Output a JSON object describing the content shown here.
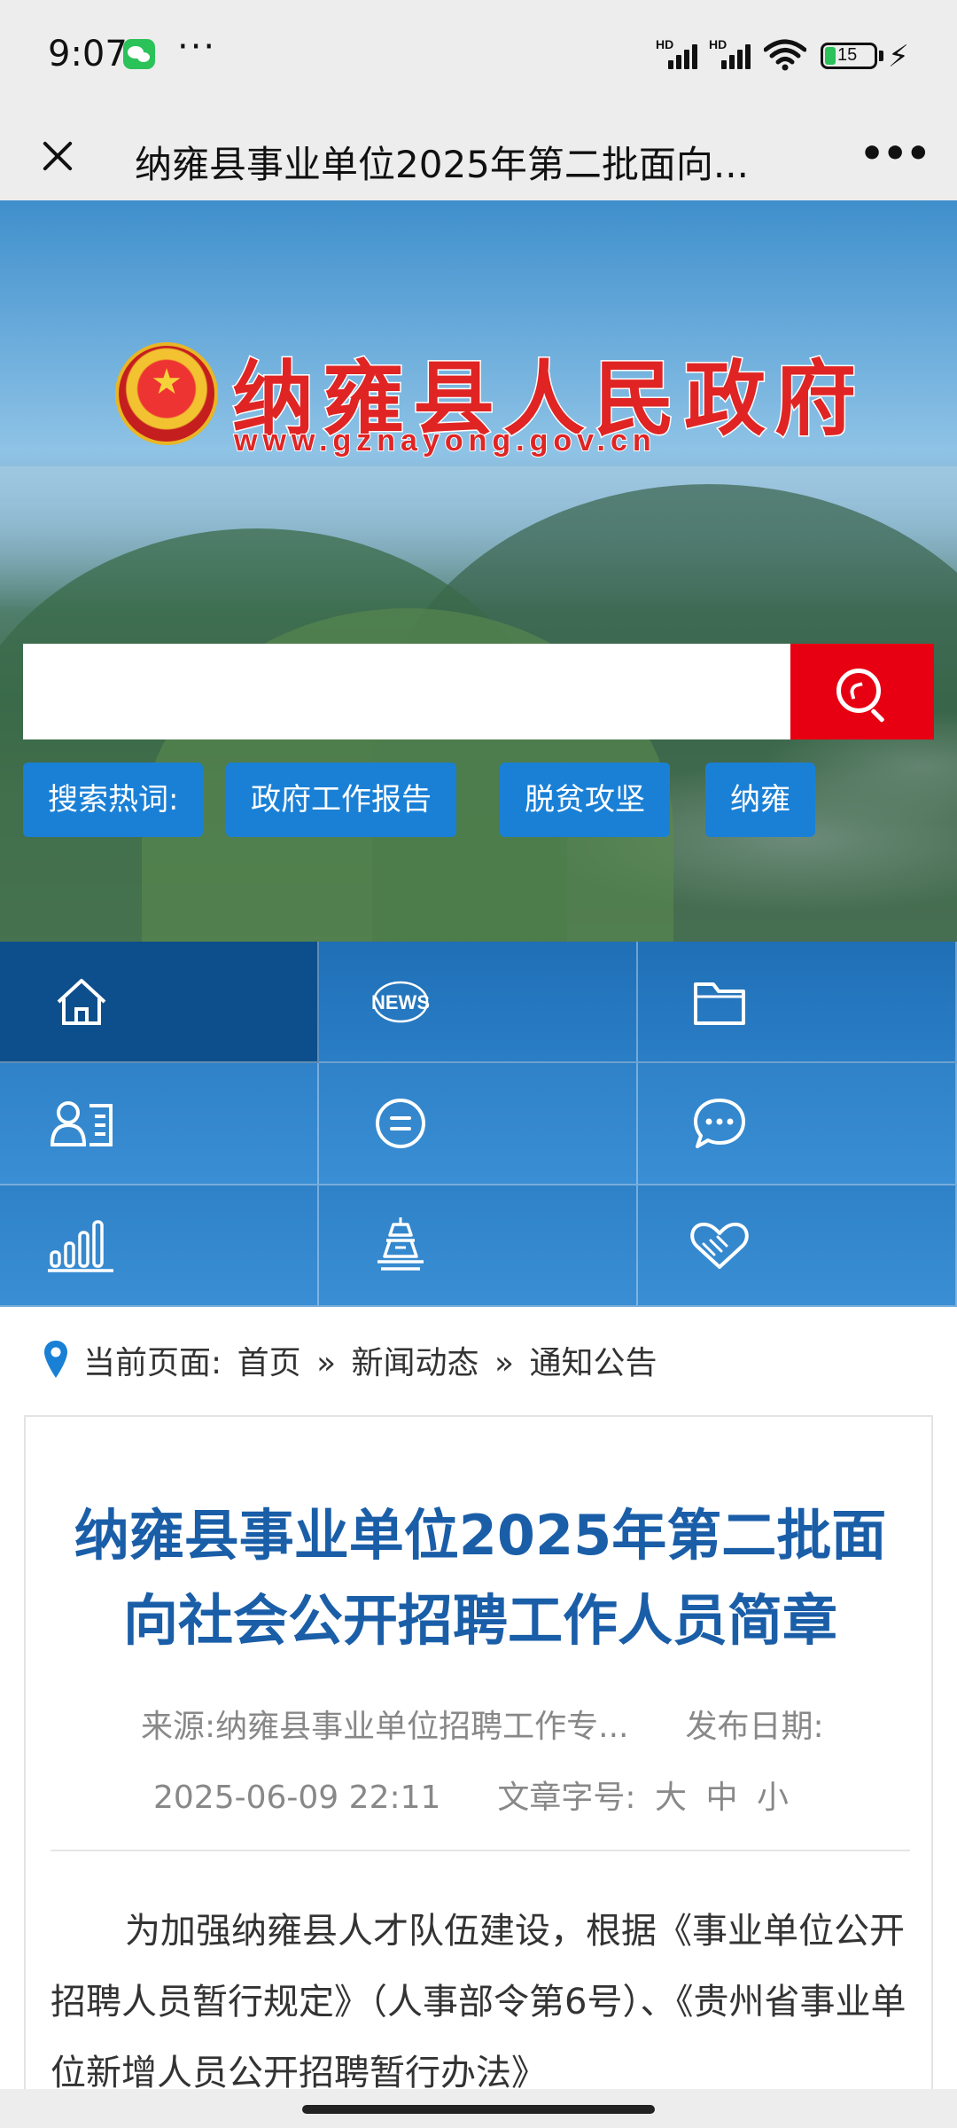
{
  "status_bar": {
    "time": "9:07",
    "dots": "···",
    "signal1_label": "HD",
    "signal2_label": "HD",
    "battery": "15"
  },
  "title_bar": {
    "title": "纳雍县事业单位2025年第二批面向..."
  },
  "banner": {
    "site_name": "纳雍县人民政府",
    "site_url": "www.gznayong.gov.cn",
    "search_placeholder": "",
    "hot_label": "搜索热词:",
    "hot_words": [
      "政府工作报告",
      "脱贫攻坚",
      "纳雍"
    ]
  },
  "nav": {
    "icons": [
      "home-icon",
      "news-icon",
      "folder-icon",
      "profile-list-icon",
      "message-icon",
      "chat-bubble-icon",
      "bar-chart-icon",
      "tower-icon",
      "heart-hands-icon"
    ],
    "news_glyph": "NEWS"
  },
  "breadcrumb": {
    "label": "当前页面:",
    "items": [
      "首页",
      "新闻动态",
      "通知公告"
    ],
    "separator": "»"
  },
  "article": {
    "title": "纳雍县事业单位2025年第二批面向社会公开招聘工作人员简章",
    "source_label": "来源:",
    "source": "纳雍县事业单位招聘工作专...",
    "date_label": "发布日期:",
    "date": "2025-06-09 22:11",
    "font_size_label": "文章字号:",
    "font_sizes": [
      "大",
      "中",
      "小"
    ],
    "body": "为加强纳雍县人才队伍建设，根据《事业单位公开招聘人员暂行规定》（人事部令第6号）、《贵州省事业单位新增人员公开招聘暂行办法》"
  },
  "colors": {
    "accent_red": "#e60012",
    "tag_blue": "#1a80d6",
    "nav_dark": "#0d4f8c",
    "title_blue": "#1a5ea8"
  }
}
